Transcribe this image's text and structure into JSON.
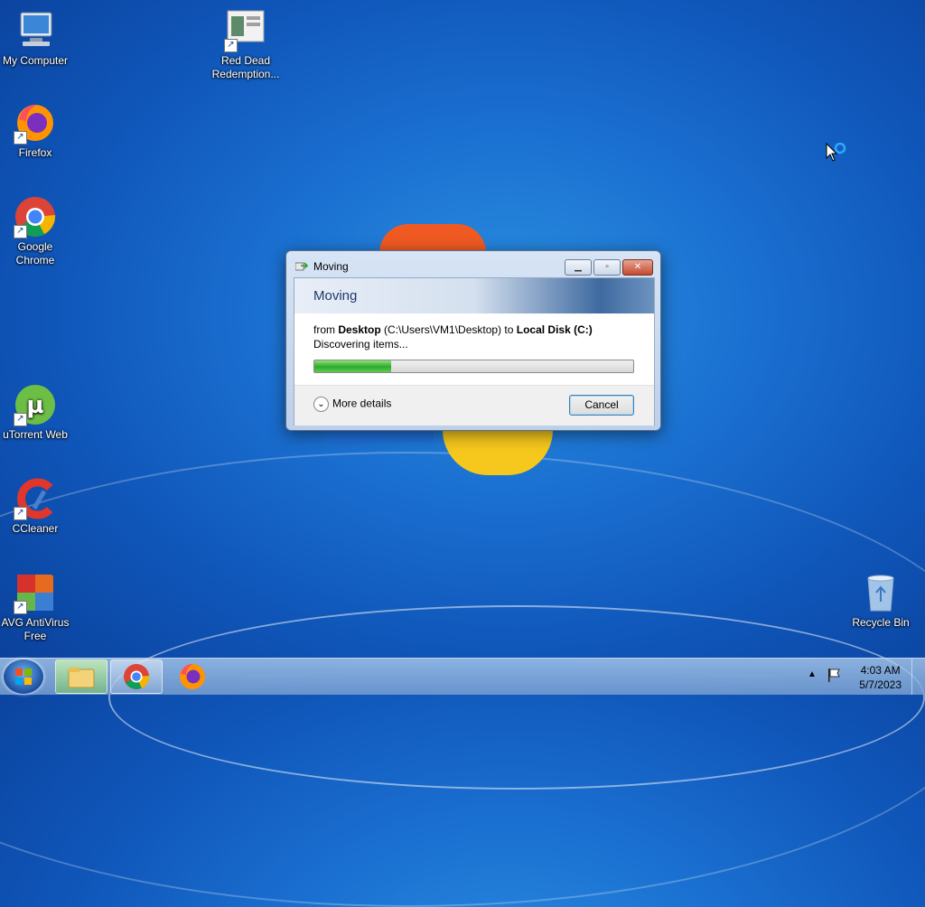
{
  "desktop": {
    "icons": [
      {
        "label": "My Computer"
      },
      {
        "label": "Red Dead Redemption..."
      },
      {
        "label": "Firefox"
      },
      {
        "label": "Google Chrome"
      },
      {
        "label": "uTorrent Web"
      },
      {
        "label": "CCleaner"
      },
      {
        "label": "AVG AntiVirus Free"
      },
      {
        "label": "Recycle Bin"
      }
    ]
  },
  "dialog": {
    "title": "Moving",
    "header": "Moving",
    "from_prefix": "from ",
    "source_name": "Desktop",
    "source_path": " (C:\\Users\\VM1\\Desktop) to ",
    "dest_name": "Local Disk (C:)",
    "status": "Discovering items...",
    "progress_fraction": 0.24,
    "more_details": "More details",
    "cancel_label": "Cancel",
    "minimize_icon": "minimize-icon",
    "maximize_icon": "maximize-icon",
    "close_icon": "close-icon"
  },
  "taskbar": {
    "pinned": [
      "windows-explorer-icon",
      "chrome-icon",
      "firefox-icon"
    ],
    "clock_time": "4:03 AM",
    "clock_date": "5/7/2023"
  },
  "colors": {
    "progress": "#2eaa2e",
    "desktop_bg": "#1a6fd0"
  }
}
